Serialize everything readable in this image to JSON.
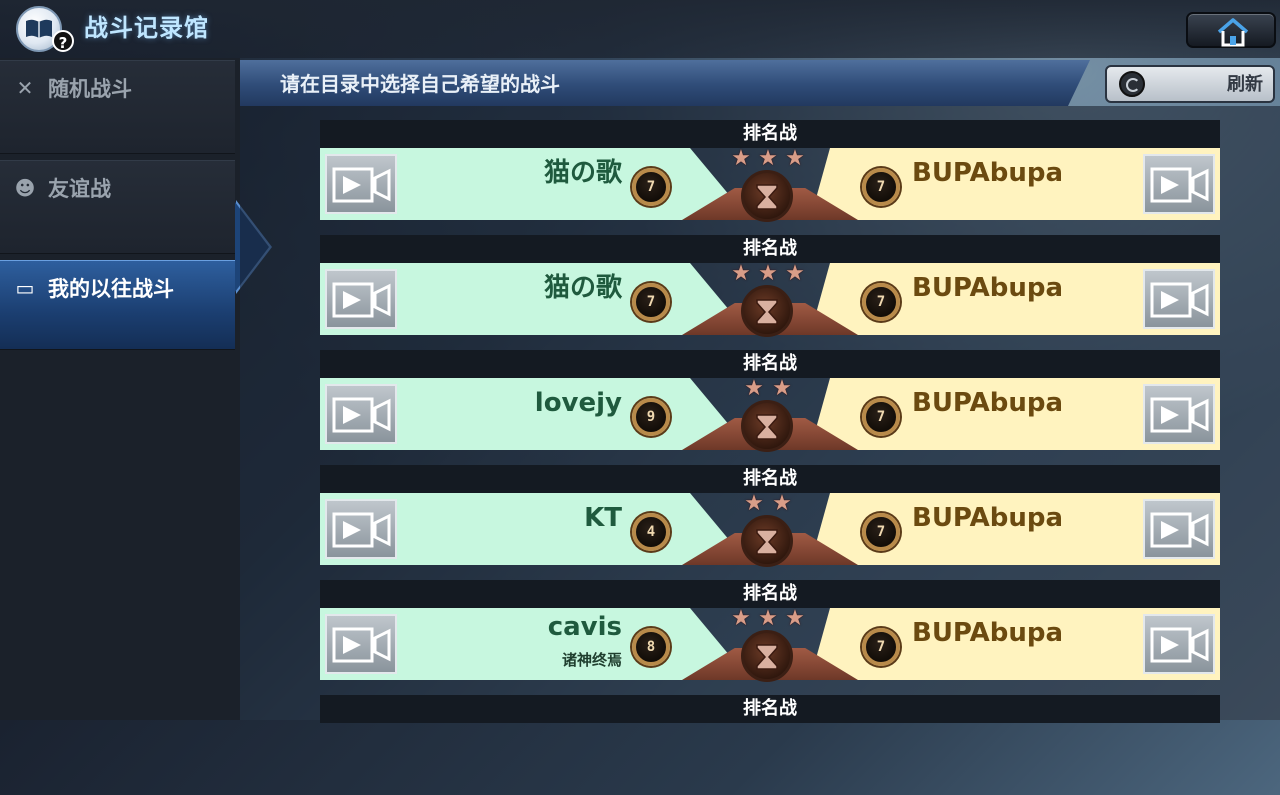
{
  "app": {
    "title": "战斗记录馆",
    "help_badge": "?"
  },
  "sidebar": {
    "items": [
      {
        "label": "随机战斗",
        "icon": "crossed-swords-icon",
        "active": false
      },
      {
        "label": "友谊战",
        "icon": "friends-icon",
        "active": false
      },
      {
        "label": "我的以往战斗",
        "icon": "open-book-icon",
        "active": true
      }
    ]
  },
  "header": {
    "text": "请在目录中选择自己希望的战斗"
  },
  "refresh": {
    "label": "刷新"
  },
  "battles": [
    {
      "type": "排名战",
      "left_name": "猫の歌",
      "left_sub": "",
      "left_rank": "7",
      "right_name": "BUPAbupa",
      "right_rank": "7",
      "stars": 3
    },
    {
      "type": "排名战",
      "left_name": "猫の歌",
      "left_sub": "",
      "left_rank": "7",
      "right_name": "BUPAbupa",
      "right_rank": "7",
      "stars": 3
    },
    {
      "type": "排名战",
      "left_name": "lovejy",
      "left_sub": "",
      "left_rank": "9",
      "right_name": "BUPAbupa",
      "right_rank": "7",
      "stars": 2
    },
    {
      "type": "排名战",
      "left_name": "KT",
      "left_sub": "",
      "left_rank": "4",
      "right_name": "BUPAbupa",
      "right_rank": "7",
      "stars": 2
    },
    {
      "type": "排名战",
      "left_name": "cavis",
      "left_sub": "诸神终焉",
      "left_rank": "8",
      "right_name": "BUPAbupa",
      "right_rank": "7",
      "stars": 3
    },
    {
      "type": "排名战"
    }
  ],
  "colors": {
    "left_lane": "#c7f7df",
    "right_lane": "#fff3bf",
    "title": "#bfe6ff",
    "active_tab": "#1d4478"
  }
}
